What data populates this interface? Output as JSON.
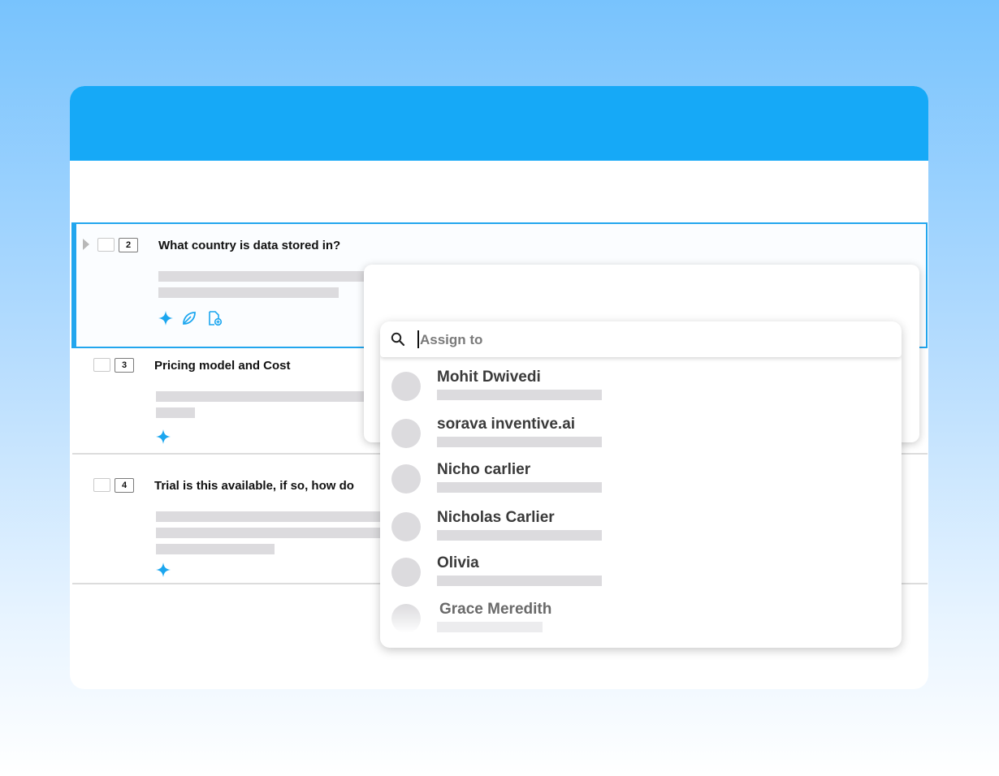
{
  "questions": [
    {
      "number": "2",
      "text": "What country is data stored in?"
    },
    {
      "number": "3",
      "text": "Pricing model and Cost"
    },
    {
      "number": "4",
      "text": "Trial is this available, if so, how do"
    }
  ],
  "icons": [
    "sparkle-icon",
    "leaf-icon",
    "document-add-icon",
    "search-icon"
  ],
  "assign": {
    "placeholder": "Assign to",
    "users": [
      {
        "name": "Mohit Dwivedi"
      },
      {
        "name": "sorava inventive.ai"
      },
      {
        "name": "Nicho carlier"
      },
      {
        "name": "Nicholas Carlier"
      },
      {
        "name": "Olivia"
      },
      {
        "name": "Grace Meredith"
      }
    ]
  },
  "colors": {
    "accent": "#16a9f7",
    "selected_border": "#22a6ee",
    "skeleton": "#dcdbde"
  }
}
